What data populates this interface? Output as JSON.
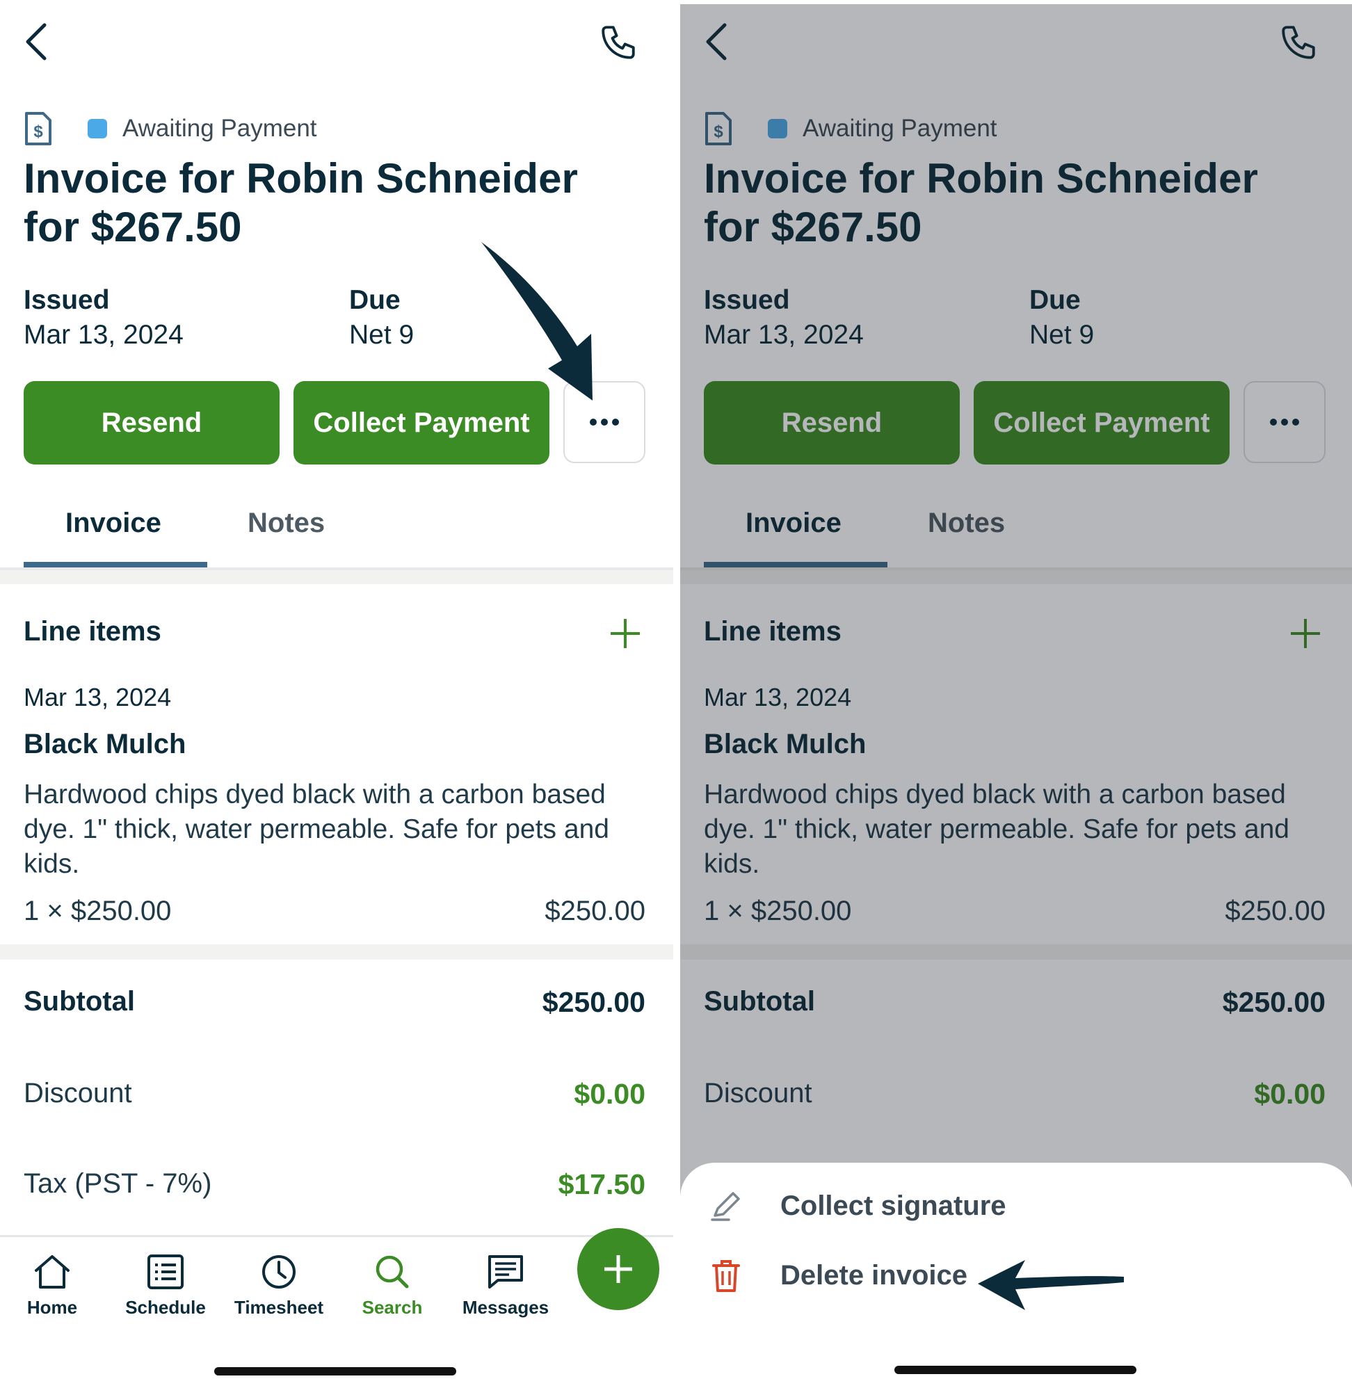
{
  "screens": [
    {
      "id": "left",
      "status": "Awaiting Payment",
      "title_line1": "Invoice for Robin Schneider",
      "title_line2": "for $267.50",
      "issued_label": "Issued",
      "issued_value": "Mar 13, 2024",
      "due_label": "Due",
      "due_value": "Net 9",
      "resend_label": "Resend",
      "collect_label": "Collect Payment",
      "tabs": [
        "Invoice",
        "Notes"
      ],
      "line_items_title": "Line items",
      "item": {
        "date": "Mar 13, 2024",
        "name": "Black Mulch",
        "description": "Hardwood chips dyed black with a carbon based dye. 1\" thick, water permeable. Safe for pets and kids.",
        "qty_price": "1 × $250.00",
        "total": "$250.00"
      },
      "subtotal_label": "Subtotal",
      "subtotal_value": "$250.00",
      "discount_label": "Discount",
      "discount_value": "$0.00",
      "tax_label": "Tax (PST - 7%)",
      "tax_value": "$17.50"
    },
    {
      "id": "right",
      "status": "Awaiting Payment",
      "title_line1": "Invoice for Robin Schneider",
      "title_line2": "for $267.50",
      "issued_label": "Issued",
      "issued_value": "Mar 13, 2024",
      "due_label": "Due",
      "due_value": "Net 9",
      "resend_label": "Resend",
      "collect_label": "Collect Payment",
      "tabs": [
        "Invoice",
        "Notes"
      ],
      "line_items_title": "Line items",
      "item": {
        "date": "Mar 13, 2024",
        "name": "Black Mulch",
        "description": "Hardwood chips dyed black with a carbon based dye. 1\" thick, water permeable. Safe for pets and kids.",
        "qty_price": "1 × $250.00",
        "total": "$250.00"
      },
      "subtotal_label": "Subtotal",
      "subtotal_value": "$250.00",
      "discount_label": "Discount",
      "discount_value": "$0.00"
    }
  ],
  "nav": [
    {
      "label": "Home",
      "icon": "house-icon"
    },
    {
      "label": "Schedule",
      "icon": "list-icon"
    },
    {
      "label": "Timesheet",
      "icon": "clock-icon"
    },
    {
      "label": "Search",
      "icon": "search-icon"
    },
    {
      "label": "Messages",
      "icon": "message-icon"
    }
  ],
  "sheet": {
    "collect_signature": "Collect signature",
    "delete_invoice": "Delete invoice"
  },
  "colors": {
    "primary_green": "#3b8c24",
    "navy": "#0b2b3a",
    "status_blue": "#4aa9e6",
    "delete_red": "#d9472b"
  }
}
